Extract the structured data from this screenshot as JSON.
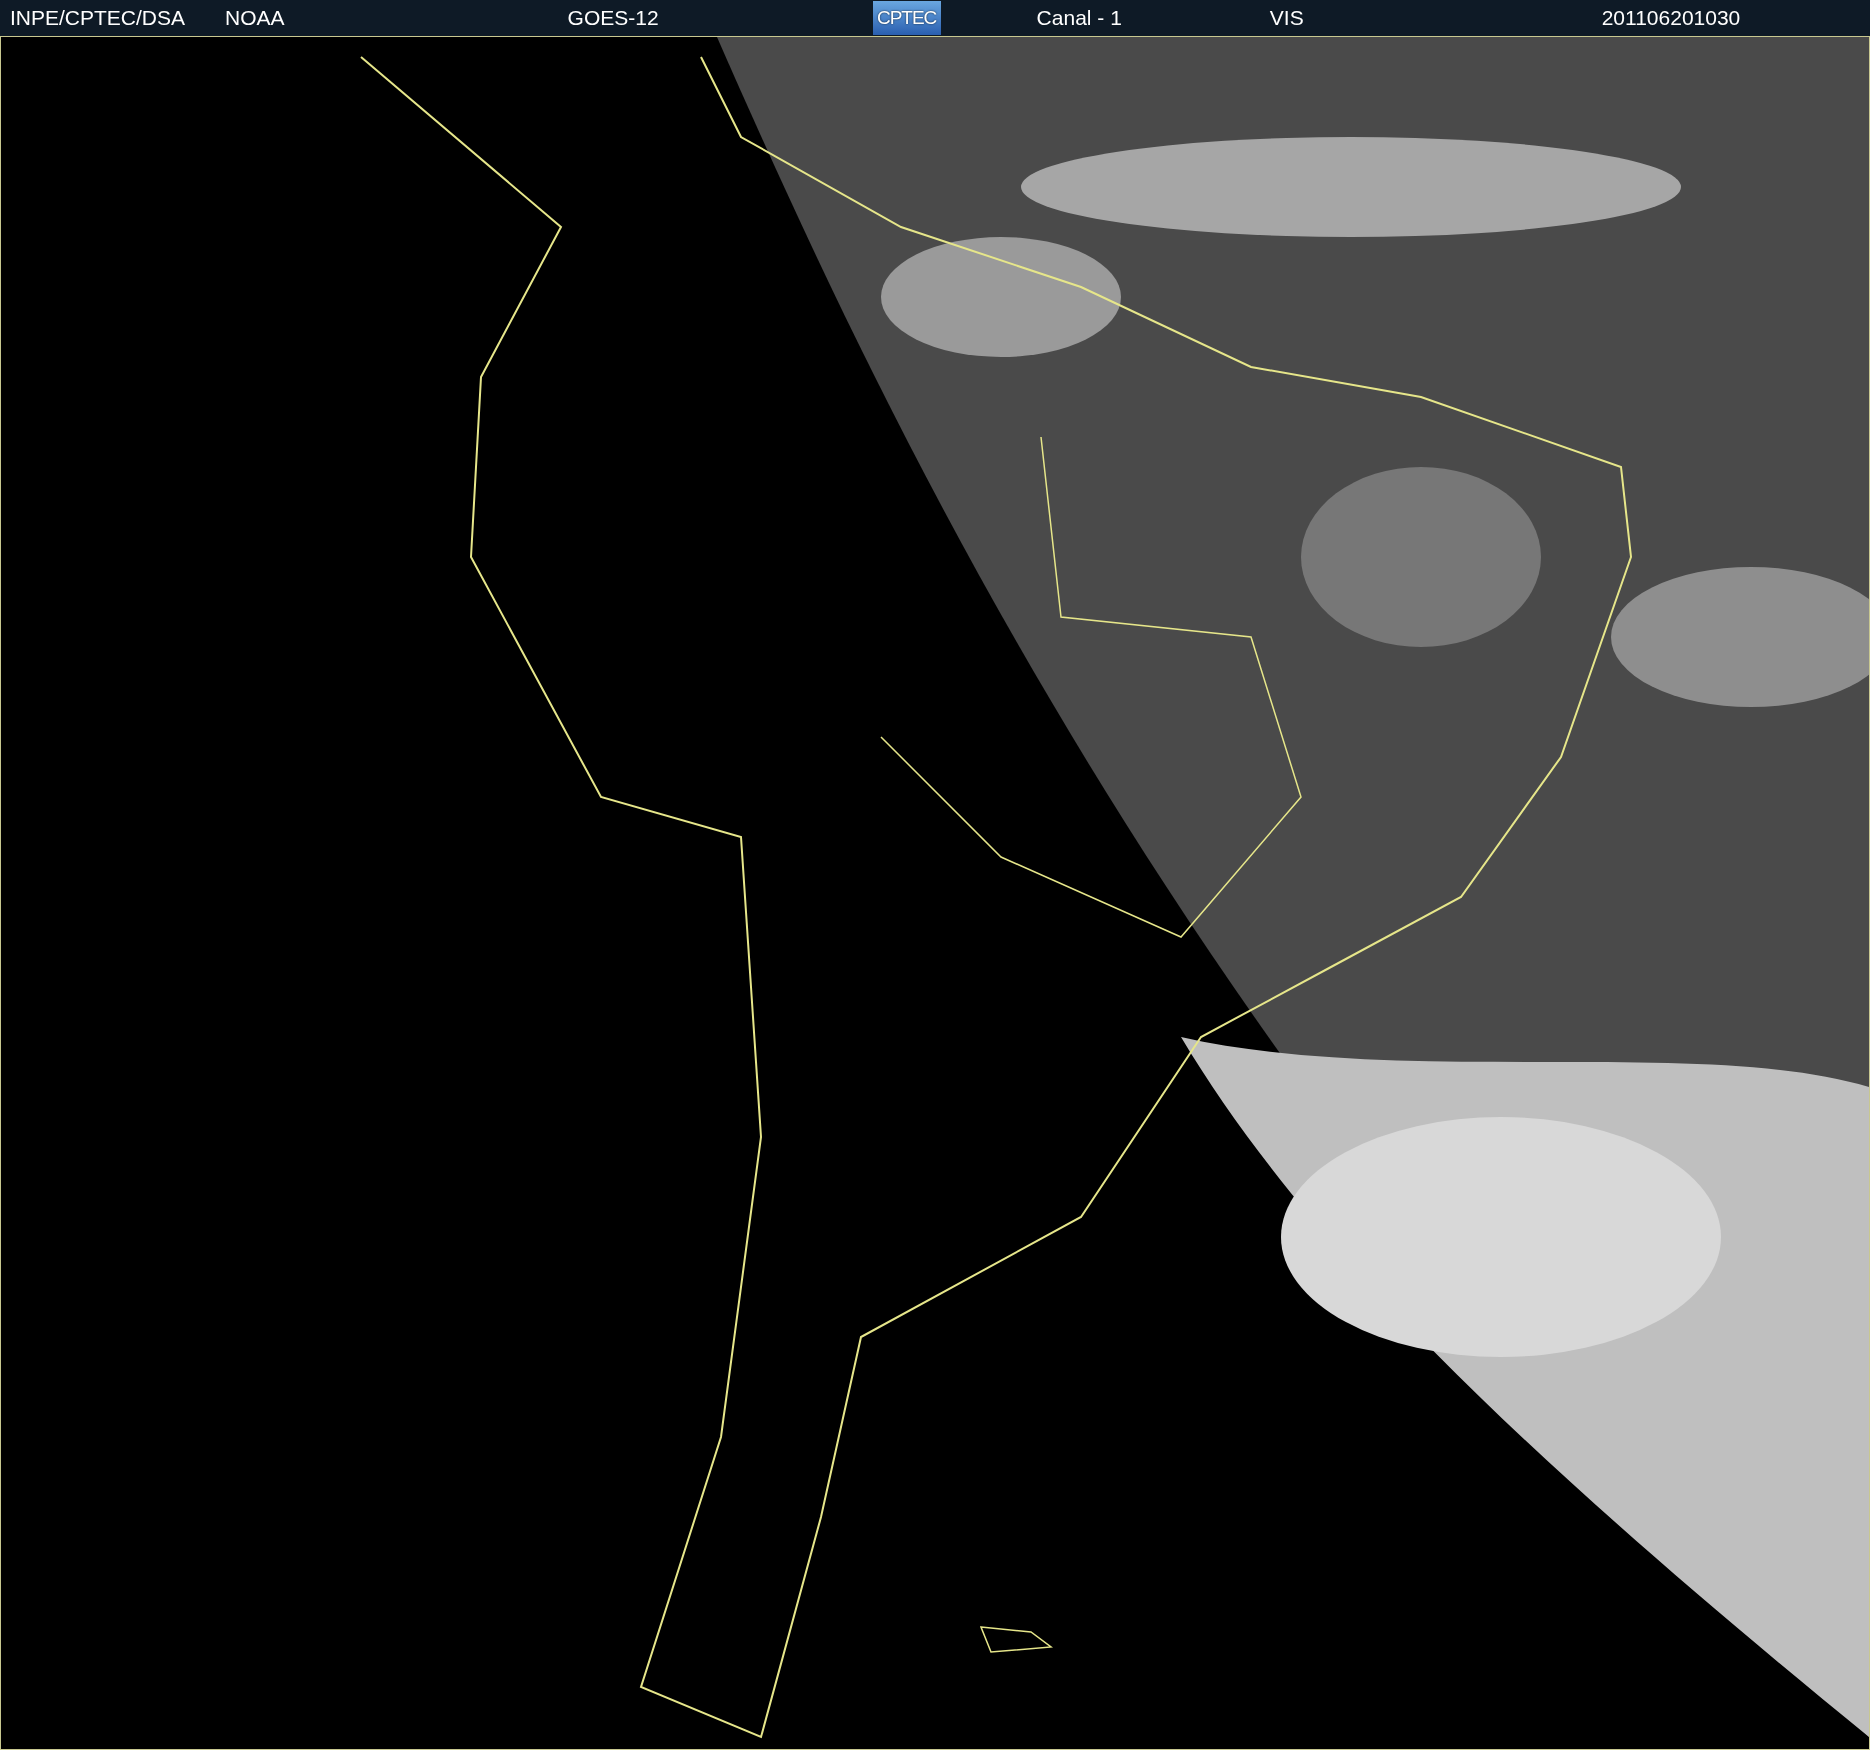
{
  "header": {
    "items": [
      {
        "kind": "text",
        "text": "INPE/CPTEC/DSA"
      },
      {
        "kind": "text",
        "text": "NOAA"
      },
      {
        "kind": "text",
        "text": "GOES-12"
      },
      {
        "kind": "logo",
        "text": "CPTEC"
      },
      {
        "kind": "text",
        "text": "Canal - 1"
      },
      {
        "kind": "text",
        "text": "VIS"
      },
      {
        "kind": "text",
        "text": "201106201030"
      }
    ]
  }
}
